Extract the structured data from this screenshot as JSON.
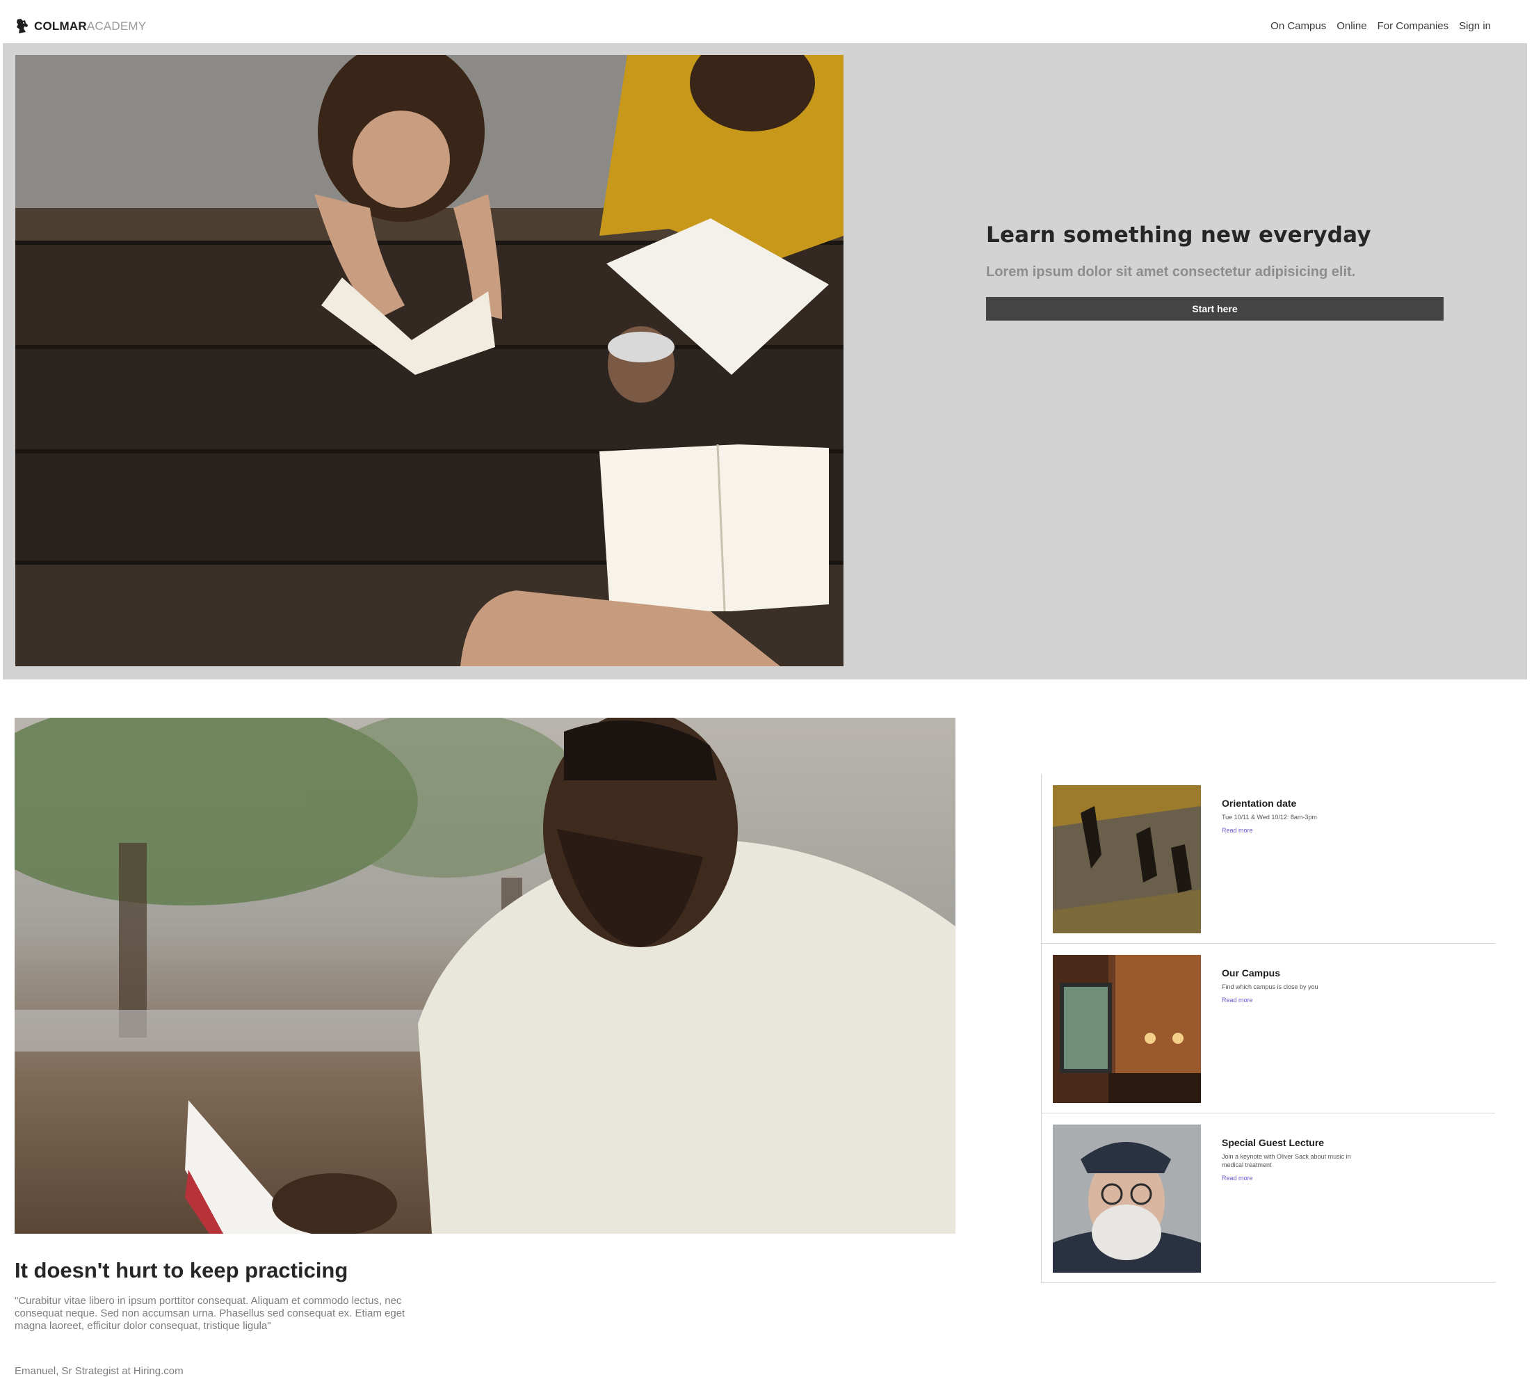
{
  "brand": {
    "name_bold": "COLMAR",
    "name_light": "ACADEMY",
    "icon": "horse-head-icon"
  },
  "nav": {
    "items": [
      "On Campus",
      "Online",
      "For Companies",
      "Sign in"
    ]
  },
  "hero": {
    "title": "Learn something new everyday",
    "subtitle": "Lorem ipsum dolor sit amet consectetur adipisicing elit.",
    "cta": "Start here",
    "photo": "students-reading-at-picnic-table",
    "colors": {
      "background": "#d3d3d3",
      "button": "#444444"
    }
  },
  "feature": {
    "photo": "man-reading-book-outdoors",
    "title": "It doesn't hurt to keep practicing",
    "quote": "\"Curabitur vitae libero in ipsum porttitor consequat. Aliquam et commodo lectus, nec consequat neque. Sed non accumsan urna. Phasellus sed consequat ex. Etiam eget magna laoreet, efficitur dolor consequat, tristique ligula\"",
    "author": "Emanuel, Sr Strategist at Hiring.com"
  },
  "events": [
    {
      "title": "Orientation date",
      "description": "Tue 10/11 & Wed 10/12: 8am-3pm",
      "link": "Read more",
      "photo": "people-walking-shadows"
    },
    {
      "title": "Our Campus",
      "description": "Find which campus is close by you",
      "link": "Read more",
      "photo": "cafe-interior-world-map"
    },
    {
      "title": "Special Guest Lecture",
      "description": "Join a keynote with Oliver Sack about music in medical treatment",
      "link": "Read more",
      "photo": "old-man-beret-glasses"
    }
  ],
  "link_color": "#6a5acd"
}
